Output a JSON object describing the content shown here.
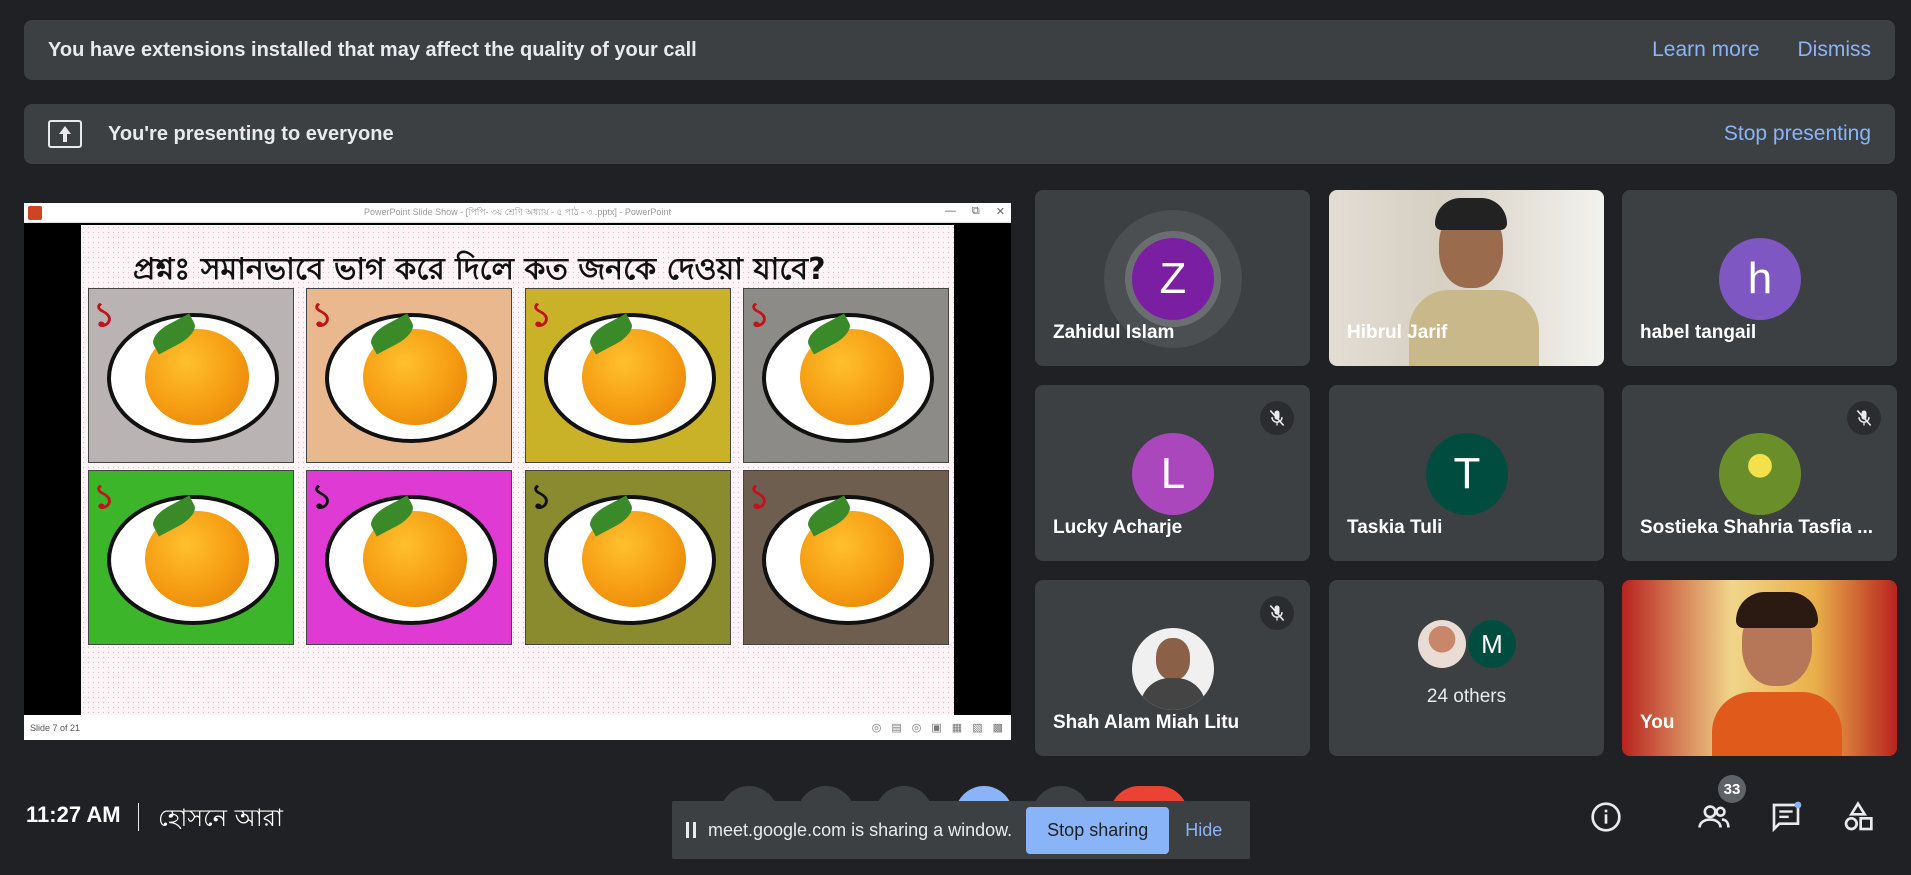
{
  "extension_banner": {
    "message": "You have extensions installed that may affect the quality of your call",
    "learn_more": "Learn more",
    "dismiss": "Dismiss"
  },
  "presenting_banner": {
    "message": "You're presenting to everyone",
    "stop": "Stop presenting"
  },
  "slide_window": {
    "title": "PowerPoint Slide Show - [পিপি- ৩য় শ্রেণি অধ্যায় - ৫ পাঠ - ৩ .pptx] - PowerPoint",
    "status": "Slide 7 of 21",
    "question": "প্রশ্নঃ সমানভাবে ভাগ করে দিলে কত জনকে দেওয়া যাবে?",
    "tiles": [
      {
        "label": "১",
        "bg": "#b9b3b3",
        "num_color": "#c0131b"
      },
      {
        "label": "১",
        "bg": "#eab88e",
        "num_color": "#c0131b"
      },
      {
        "label": "১",
        "bg": "#c9b227",
        "num_color": "#c0131b"
      },
      {
        "label": "১",
        "bg": "#8c8b87",
        "num_color": "#c0131b"
      },
      {
        "label": "১",
        "bg": "#3cb52a",
        "num_color": "#c0131b"
      },
      {
        "label": "১",
        "bg": "#e03ad4",
        "num_color": "#111111"
      },
      {
        "label": "১",
        "bg": "#8a8a2e",
        "num_color": "#111111"
      },
      {
        "label": "১",
        "bg": "#6e5e50",
        "num_color": "#c0131b"
      }
    ]
  },
  "participants": [
    {
      "name": "Zahidul Islam",
      "initial": "Z",
      "color": "#7b1fa2",
      "muted": false,
      "speaking": true
    },
    {
      "name": "Hibrul Jarif",
      "type": "video"
    },
    {
      "name": "habel tangail",
      "initial": "h",
      "color": "#7e57c2",
      "muted": false
    },
    {
      "name": "Lucky Acharje",
      "initial": "L",
      "color": "#ab47bc",
      "muted": true
    },
    {
      "name": "Taskia Tuli",
      "initial": "T",
      "color": "#004d40",
      "muted": false
    },
    {
      "name": "Sostieka Shahria Tasfia ...",
      "type": "photo-bird",
      "muted": true
    },
    {
      "name": "Shah Alam Miah Litu",
      "type": "photo-person",
      "muted": true
    },
    {
      "name": "24 others",
      "type": "others",
      "initial": "M",
      "color": "#004d40"
    },
    {
      "name": "You",
      "type": "self-video"
    }
  ],
  "bottom_bar": {
    "time": "11:27 AM",
    "meeting_name": "হোসনে আরা",
    "share_message": "meet.google.com is sharing a window.",
    "stop_sharing": "Stop sharing",
    "hide": "Hide",
    "people_count": "33",
    "icons": [
      "info-icon",
      "people-icon",
      "chat-icon",
      "activities-icon"
    ]
  }
}
